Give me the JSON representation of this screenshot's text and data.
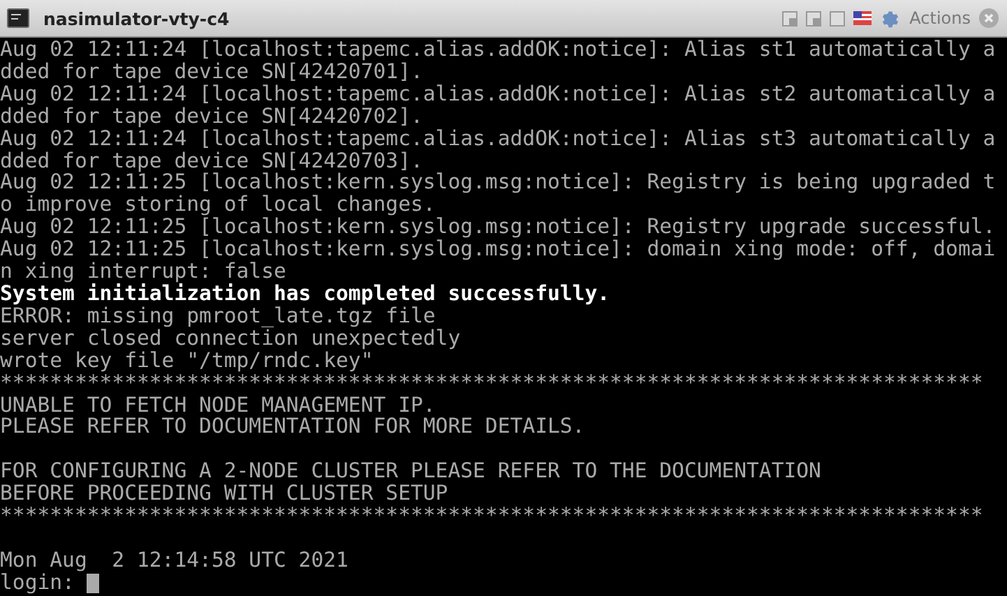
{
  "window": {
    "title": "nasimulator-vty-c4",
    "actions_label": "Actions"
  },
  "terminal": {
    "lines": [
      {
        "kind": "normal",
        "text": "Aug 02 12:11:24 [localhost:tapemc.alias.addOK:notice]: Alias st1 automatically a"
      },
      {
        "kind": "normal",
        "text": "dded for tape device SN[42420701]."
      },
      {
        "kind": "normal",
        "text": "Aug 02 12:11:24 [localhost:tapemc.alias.addOK:notice]: Alias st2 automatically a"
      },
      {
        "kind": "normal",
        "text": "dded for tape device SN[42420702]."
      },
      {
        "kind": "normal",
        "text": "Aug 02 12:11:24 [localhost:tapemc.alias.addOK:notice]: Alias st3 automatically a"
      },
      {
        "kind": "normal",
        "text": "dded for tape device SN[42420703]."
      },
      {
        "kind": "normal",
        "text": "Aug 02 12:11:25 [localhost:kern.syslog.msg:notice]: Registry is being upgraded t"
      },
      {
        "kind": "normal",
        "text": "o improve storing of local changes."
      },
      {
        "kind": "normal",
        "text": "Aug 02 12:11:25 [localhost:kern.syslog.msg:notice]: Registry upgrade successful."
      },
      {
        "kind": "normal",
        "text": "Aug 02 12:11:25 [localhost:kern.syslog.msg:notice]: domain xing mode: off, domai"
      },
      {
        "kind": "normal",
        "text": "n xing interrupt: false"
      },
      {
        "kind": "bright",
        "text": "System initialization has completed successfully."
      },
      {
        "kind": "normal",
        "text": "ERROR: missing pmroot_late.tgz file"
      },
      {
        "kind": "normal",
        "text": "server closed connection unexpectedly"
      },
      {
        "kind": "normal",
        "text": "wrote key file \"/tmp/rndc.key\""
      },
      {
        "kind": "normal",
        "text": "*******************************************************************************"
      },
      {
        "kind": "normal",
        "text": "UNABLE TO FETCH NODE MANAGEMENT IP."
      },
      {
        "kind": "normal",
        "text": "PLEASE REFER TO DOCUMENTATION FOR MORE DETAILS."
      },
      {
        "kind": "blank"
      },
      {
        "kind": "normal",
        "text": "FOR CONFIGURING A 2-NODE CLUSTER PLEASE REFER TO THE DOCUMENTATION"
      },
      {
        "kind": "normal",
        "text": "BEFORE PROCEEDING WITH CLUSTER SETUP"
      },
      {
        "kind": "normal",
        "text": "*******************************************************************************"
      },
      {
        "kind": "blank"
      },
      {
        "kind": "normal",
        "text": "Mon Aug  2 12:14:58 UTC 2021"
      }
    ],
    "prompt": "login:"
  }
}
